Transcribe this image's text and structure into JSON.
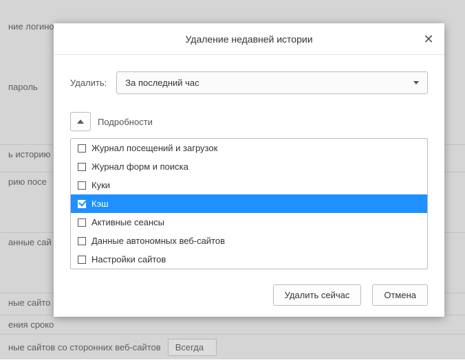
{
  "background": {
    "rows": [
      "ние логинов",
      "пароль",
      "ь историю",
      "рию посе",
      "анные сай",
      "ные сайто",
      "ения сроко"
    ],
    "bottom": {
      "label": "ные сайтов со сторонних веб-сайтов",
      "select_value": "Всегда"
    }
  },
  "dialog": {
    "title": "Удаление недавней истории",
    "delete_label": "Удалить:",
    "range_value": "За последний час",
    "details_label": "Подробности",
    "items": [
      {
        "label": "Журнал посещений и загрузок",
        "checked": false,
        "selected": false
      },
      {
        "label": "Журнал форм и поиска",
        "checked": false,
        "selected": false
      },
      {
        "label": "Куки",
        "checked": false,
        "selected": false
      },
      {
        "label": "Кэш",
        "checked": true,
        "selected": true
      },
      {
        "label": "Активные сеансы",
        "checked": false,
        "selected": false
      },
      {
        "label": "Данные автономных веб-сайтов",
        "checked": false,
        "selected": false
      },
      {
        "label": "Настройки сайтов",
        "checked": false,
        "selected": false
      }
    ],
    "buttons": {
      "clear_now": "Удалить сейчас",
      "cancel": "Отмена"
    }
  }
}
